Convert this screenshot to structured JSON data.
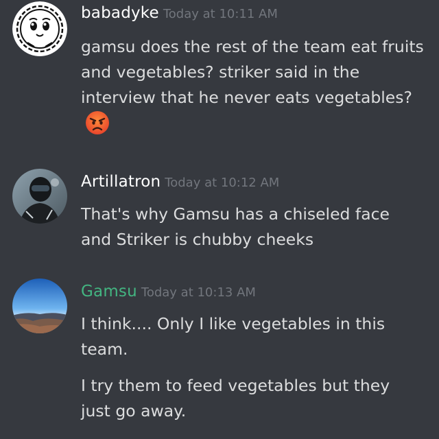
{
  "messages": [
    {
      "username": "babadyke",
      "timestamp": "Today at 10:11 AM",
      "avatar_icon": "cartoon-face-avatar",
      "username_color": "#ffffff",
      "lines": [
        "gamsu does the rest of the team eat fruits and vegetables? striker said in the interview that he never eats vegetables?"
      ],
      "emoji": "angry-face-emoji"
    },
    {
      "username": "Artillatron",
      "timestamp": "Today at 10:12 AM",
      "avatar_icon": "helmet-rider-avatar",
      "username_color": "#ffffff",
      "lines": [
        "That's why Gamsu has a chiseled face and Striker is chubby cheeks"
      ]
    },
    {
      "username": "Gamsu",
      "timestamp": "Today at 10:13 AM",
      "avatar_icon": "canyon-landscape-avatar",
      "username_color": "#43b581",
      "lines": [
        "I think.... Only I like vegetables in this team.",
        "I try them to feed vegetables but they just go away."
      ]
    }
  ]
}
